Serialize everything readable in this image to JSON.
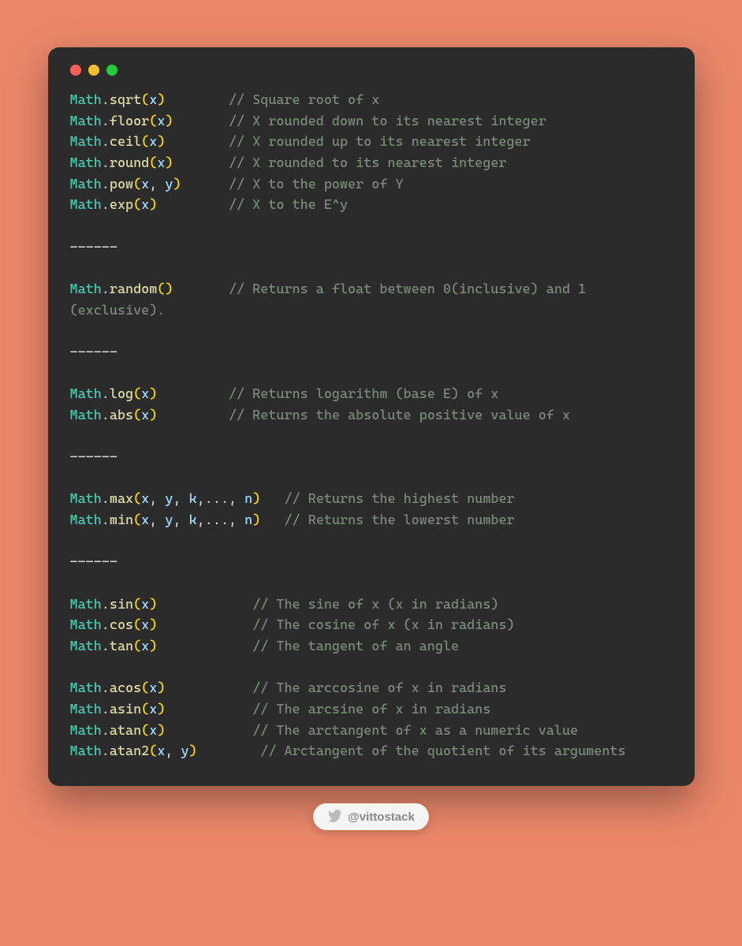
{
  "separator": "------",
  "groups": [
    {
      "lines": [
        {
          "obj": "Math",
          "method": "sqrt",
          "params": [
            "x"
          ],
          "pad": 8,
          "comment": "// Square root of x"
        },
        {
          "obj": "Math",
          "method": "floor",
          "params": [
            "x"
          ],
          "pad": 7,
          "comment": "// X rounded down to its nearest integer"
        },
        {
          "obj": "Math",
          "method": "ceil",
          "params": [
            "x"
          ],
          "pad": 8,
          "comment": "// X rounded up to its nearest integer"
        },
        {
          "obj": "Math",
          "method": "round",
          "params": [
            "x"
          ],
          "pad": 7,
          "comment": "// X rounded to its nearest integer"
        },
        {
          "obj": "Math",
          "method": "pow",
          "params": [
            "x",
            "y"
          ],
          "pad": 6,
          "comment": "// X to the power of Y"
        },
        {
          "obj": "Math",
          "method": "exp",
          "params": [
            "x"
          ],
          "pad": 9,
          "comment": "// X to the E^y"
        }
      ]
    },
    {
      "lines": [
        {
          "obj": "Math",
          "method": "random",
          "params": [],
          "pad": 7,
          "comment": "// Returns a float between 0(inclusive) and 1 (exclusive)."
        }
      ]
    },
    {
      "lines": [
        {
          "obj": "Math",
          "method": "log",
          "params": [
            "x"
          ],
          "pad": 9,
          "comment": "// Returns logarithm (base E) of x"
        },
        {
          "obj": "Math",
          "method": "abs",
          "params": [
            "x"
          ],
          "pad": 9,
          "comment": "// Returns the absolute positive value of x"
        }
      ]
    },
    {
      "lines": [
        {
          "obj": "Math",
          "method": "max",
          "params": [
            "x",
            "y",
            "k",
            "...",
            "n"
          ],
          "pad": 3,
          "comment": "// Returns the highest number"
        },
        {
          "obj": "Math",
          "method": "min",
          "params": [
            "x",
            "y",
            "k",
            "...",
            "n"
          ],
          "pad": 3,
          "comment": "// Returns the lowerst number"
        }
      ]
    },
    {
      "lines": [
        {
          "obj": "Math",
          "method": "sin",
          "params": [
            "x"
          ],
          "pad": 12,
          "comment": "// The sine of x (x in radians)"
        },
        {
          "obj": "Math",
          "method": "cos",
          "params": [
            "x"
          ],
          "pad": 12,
          "comment": "// The cosine of x (x in radians)"
        },
        {
          "obj": "Math",
          "method": "tan",
          "params": [
            "x"
          ],
          "pad": 12,
          "comment": "// The tangent of an angle"
        },
        {
          "blank": true
        },
        {
          "obj": "Math",
          "method": "acos",
          "params": [
            "x"
          ],
          "pad": 11,
          "comment": "// The arccosine of x in radians"
        },
        {
          "obj": "Math",
          "method": "asin",
          "params": [
            "x"
          ],
          "pad": 11,
          "comment": "// The arcsine of x in radians"
        },
        {
          "obj": "Math",
          "method": "atan",
          "params": [
            "x"
          ],
          "pad": 11,
          "comment": "// The arctangent of x as a numeric value"
        },
        {
          "obj": "Math",
          "method": "atan2",
          "params": [
            "x",
            "y"
          ],
          "pad": 8,
          "comment": "// Arctangent of the quotient of its arguments"
        }
      ]
    }
  ],
  "footer": {
    "handle": "@vittostack"
  }
}
